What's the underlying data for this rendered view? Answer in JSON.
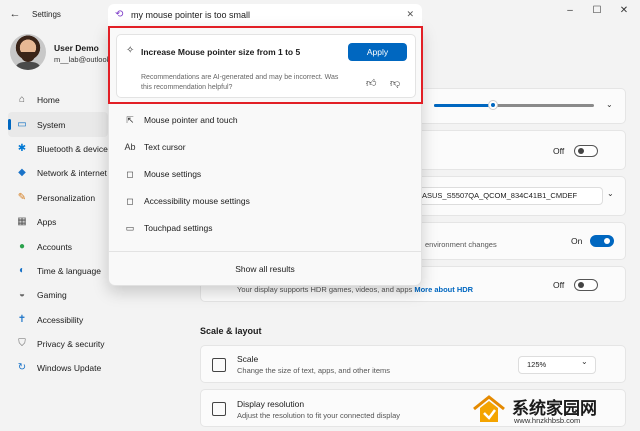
{
  "window": {
    "title": "Settings",
    "back_icon": "back-arrow-icon",
    "controls": {
      "minimize": "–",
      "maximize": "☐",
      "close": "✕"
    }
  },
  "profile": {
    "name": "User Demo",
    "email": "m__lab@outlook.com"
  },
  "sidebar": {
    "items": [
      {
        "label": "Home",
        "icon": "home-icon",
        "glyph": "⌂",
        "color": "#555555",
        "active": false
      },
      {
        "label": "System",
        "icon": "system-icon",
        "glyph": "▭",
        "color": "#0067c0",
        "active": true
      },
      {
        "label": "Bluetooth & devices",
        "icon": "bluetooth-icon",
        "glyph": "✱",
        "color": "#0078d4",
        "active": false
      },
      {
        "label": "Network & internet",
        "icon": "wifi-icon",
        "glyph": "◆",
        "color": "#1a73c8",
        "active": false
      },
      {
        "label": "Personalization",
        "icon": "brush-icon",
        "glyph": "✎",
        "color": "#d47a1a",
        "active": false
      },
      {
        "label": "Apps",
        "icon": "apps-icon",
        "glyph": "▦",
        "color": "#555555",
        "active": false
      },
      {
        "label": "Accounts",
        "icon": "person-icon",
        "glyph": "●",
        "color": "#2ba24c",
        "active": false
      },
      {
        "label": "Time & language",
        "icon": "globe-clock-icon",
        "glyph": "◐",
        "color": "#1a73c8",
        "active": false
      },
      {
        "label": "Gaming",
        "icon": "gamepad-icon",
        "glyph": "◒",
        "color": "#666666",
        "active": false
      },
      {
        "label": "Accessibility",
        "icon": "accessibility-icon",
        "glyph": "✝",
        "color": "#1a73c8",
        "active": false
      },
      {
        "label": "Privacy & security",
        "icon": "shield-icon",
        "glyph": "⛉",
        "color": "#666666",
        "active": false
      },
      {
        "label": "Windows Update",
        "icon": "update-icon",
        "glyph": "↻",
        "color": "#1a73c8",
        "active": false
      }
    ]
  },
  "search": {
    "query": "my mouse pointer is too small",
    "clear_label": "✕",
    "recommendation": {
      "title": "Increase Mouse pointer size from 1 to 5",
      "apply_label": "Apply",
      "note": "Recommendations are AI-generated and may be incorrect. Was this recommendation helpful?"
    },
    "results": [
      {
        "label": "Mouse pointer and touch",
        "icon": "pointer-touch-icon",
        "glyph": "⇱"
      },
      {
        "label": "Text cursor",
        "icon": "text-cursor-icon",
        "glyph": "Ab"
      },
      {
        "label": "Mouse settings",
        "icon": "mouse-icon",
        "glyph": "◻"
      },
      {
        "label": "Accessibility mouse settings",
        "icon": "mouse-icon",
        "glyph": "◻"
      },
      {
        "label": "Touchpad settings",
        "icon": "touchpad-icon",
        "glyph": "▭"
      }
    ],
    "show_all_label": "Show all results"
  },
  "main": {
    "brightness_level": 0.37,
    "night_light": {
      "state": "Off"
    },
    "display_dropdown": {
      "value": "ASUS_S5507QA_QCOM_834C41B1_CMDEF"
    },
    "adaptive": {
      "text": "environment changes",
      "state": "On"
    },
    "hdr": {
      "text": "Your display supports HDR games, videos, and apps",
      "link": "More about HDR",
      "state": "Off"
    },
    "section_title": "Scale & layout",
    "scale": {
      "title": "Scale",
      "subtitle": "Change the size of text, apps, and other items",
      "value": "125%"
    },
    "resolution": {
      "title": "Display resolution",
      "subtitle": "Adjust the resolution to fit your connected display"
    }
  },
  "watermark": {
    "title": "系统家园网",
    "url": "www.hnzkhbsb.com"
  },
  "colors": {
    "accent": "#0067c0",
    "highlight_border": "#e21f26"
  }
}
